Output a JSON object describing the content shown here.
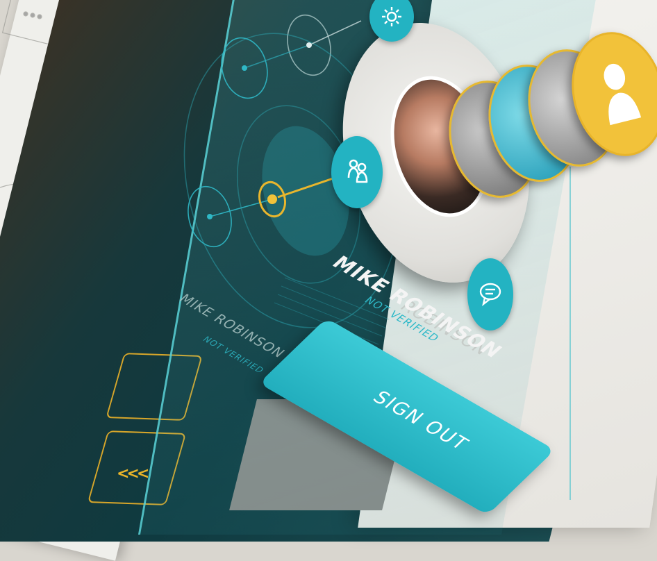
{
  "profile_front": {
    "name": "MIKE ROBINSON",
    "status": "NOT VERIFIED"
  },
  "profile_back": {
    "name": "MIKE ROBINSON",
    "status": "NOT VERIFIED"
  },
  "profile_ghost": {
    "name": "ROBINSON"
  },
  "actions": {
    "sign_out_label": "SIGN OUT"
  },
  "icons": {
    "settings": "gear-icon",
    "contacts": "people-icon",
    "chat": "chat-bubble-icon",
    "profile": "person-icon",
    "chevrons": "chevron-left-icon"
  },
  "chevron_glyph": "<<<",
  "colors": {
    "accent_teal": "#23b3c2",
    "accent_yellow": "#f2c23a",
    "dark_bg": "#0f3a40"
  }
}
